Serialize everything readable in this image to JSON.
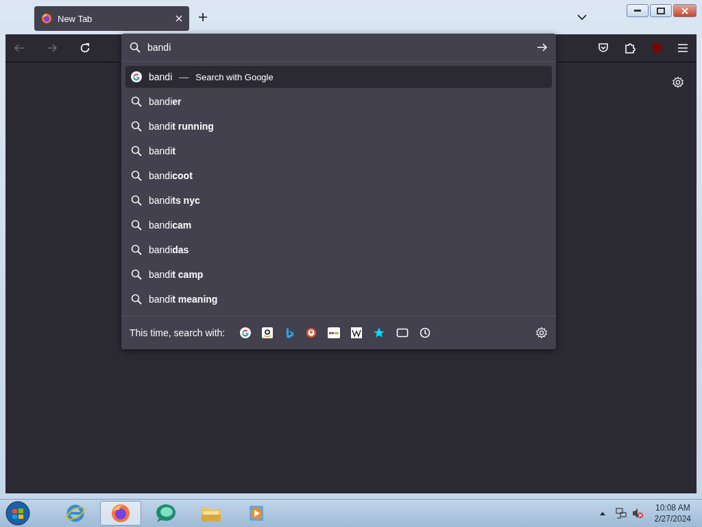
{
  "tabs": [
    {
      "label": "New Tab",
      "selected": true
    }
  ],
  "url_bar": {
    "value": "bandi"
  },
  "suggestions": [
    {
      "kind": "engine",
      "text": "bandi",
      "separator": "—",
      "action": "Search with Google",
      "selected": true
    },
    {
      "kind": "search",
      "text": "bandi**er**",
      "selected": false
    },
    {
      "kind": "search",
      "text": "bandi**t running**",
      "selected": false
    },
    {
      "kind": "search",
      "text": "bandi**t**",
      "selected": false
    },
    {
      "kind": "search",
      "text": "bandi**coot**",
      "selected": false
    },
    {
      "kind": "search",
      "text": "bandi**ts nyc**",
      "selected": false
    },
    {
      "kind": "search",
      "text": "bandi**cam**",
      "selected": false
    },
    {
      "kind": "search",
      "text": "bandi**das**",
      "selected": false
    },
    {
      "kind": "search",
      "text": "bandi**t camp**",
      "selected": false
    },
    {
      "kind": "search",
      "text": "bandi**t meaning**",
      "selected": false
    }
  ],
  "search_with": {
    "label": "This time, search with:"
  },
  "taskbar": {
    "items": [
      {
        "selected": false
      },
      {
        "selected": true
      },
      {
        "selected": false
      },
      {
        "selected": false
      },
      {
        "selected": false
      }
    ],
    "time": "10:08 AM",
    "date": "2/27/2024"
  }
}
